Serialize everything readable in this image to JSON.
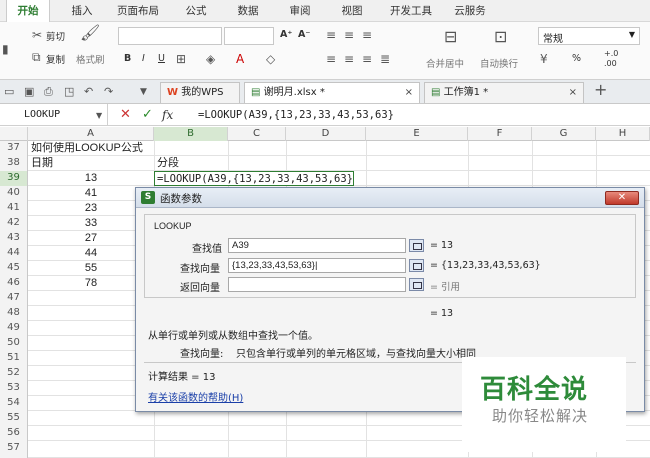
{
  "menu": {
    "tabs": [
      "开始",
      "插入",
      "页面布局",
      "公式",
      "数据",
      "审阅",
      "视图",
      "开发工具",
      "云服务"
    ]
  },
  "ribbon": {
    "cut": "剪切",
    "copy": "复制",
    "format_painter": "格式刷",
    "bold": "B",
    "italic": "I",
    "underline": "U",
    "font_size_up": "A⁺",
    "font_size_down": "A⁻",
    "merge": "合并居中",
    "wrap": "自动换行",
    "number_format": "常规",
    "percent": "%",
    "decimal_add": "+.0",
    "decimal_remove": ".00"
  },
  "doc_tabs": {
    "my_wps": "我的WPS",
    "file1": "谢明月.xlsx *",
    "file2": "工作簿1 *",
    "add": "+"
  },
  "formula_bar": {
    "name_box": "LOOKUP",
    "fx": "fx",
    "formula": "=LOOKUP(A39,{13,23,33,43,53,63}"
  },
  "grid": {
    "columns": [
      "A",
      "B",
      "C",
      "D",
      "E",
      "F",
      "G",
      "H"
    ],
    "row_numbers": [
      "37",
      "38",
      "39",
      "40",
      "41",
      "42",
      "43",
      "44",
      "45",
      "46",
      "47",
      "48",
      "49",
      "50",
      "51",
      "52",
      "53",
      "54",
      "55",
      "56",
      "57"
    ],
    "A": [
      "如何使用LOOKUP公式",
      "日期",
      "13",
      "41",
      "23",
      "33",
      "27",
      "44",
      "55",
      "78"
    ],
    "B": [
      "",
      "分段",
      "=LOOKUP(A39,{13,23,33,43,53,63}"
    ]
  },
  "dialog": {
    "title": "函数参数",
    "function_name": "LOOKUP",
    "arg1_label": "查找值",
    "arg1_value": "A39",
    "arg1_result": "= 13",
    "arg2_label": "查找向量",
    "arg2_value": "{13,23,33,43,53,63}|",
    "arg2_result": "= {13,23,33,43,53,63}",
    "arg3_label": "返回向量",
    "arg3_value": "",
    "arg3_result": "= 引用",
    "overall_result": "= 13",
    "description": "从单行或单列或从数组中查找一个值。",
    "param_label": "查找向量:",
    "param_desc": "只包含单行或单列的单元格区域，与查找向量大小相同",
    "calc_result": "计算结果 = 13",
    "help_link": "有关该函数的帮助(H)"
  },
  "watermark": {
    "title": "百科全说",
    "subtitle": "助你轻松解决"
  },
  "colors": {
    "accent": "#2e7d32",
    "selected_header": "#d7e8d2",
    "dialog_border": "#7a8ba6",
    "link": "#1a3fa8",
    "watermark": "#2e8b3a"
  }
}
